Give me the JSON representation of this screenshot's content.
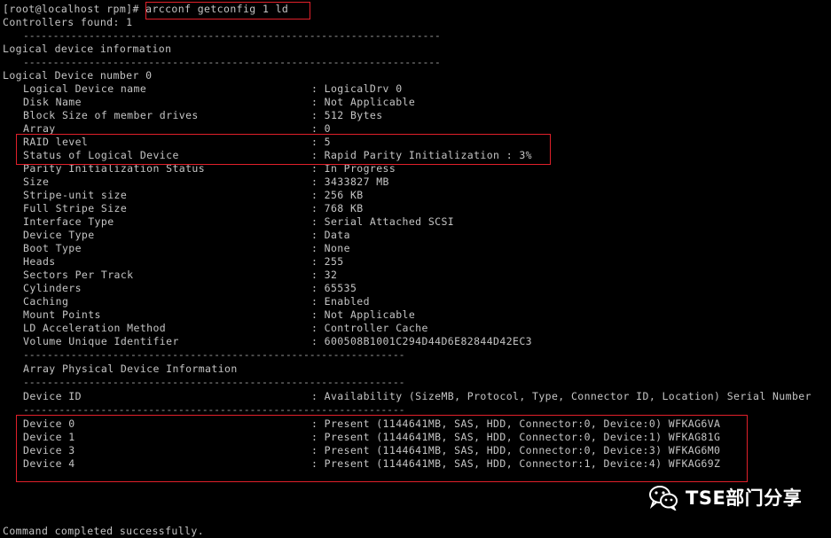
{
  "terminal": {
    "prompt": "[root@localhost rpm]#",
    "command": "arcconf getconfig 1 ld",
    "controllers_found": "Controllers found: 1",
    "separator": "----------------------------------------------------------------------",
    "section_title": "Logical device information",
    "ld_number_line": "Logical Device number 0",
    "properties": [
      {
        "key": "Logical Device name",
        "value": ": LogicalDrv 0"
      },
      {
        "key": "Disk Name",
        "value": ": Not Applicable"
      },
      {
        "key": "Block Size of member drives",
        "value": ": 512 Bytes"
      },
      {
        "key": "Array",
        "value": ": 0"
      },
      {
        "key": "RAID level",
        "value": ": 5"
      },
      {
        "key": "Status of Logical Device",
        "value": ": Rapid Parity Initialization : 3%"
      },
      {
        "key": "Parity Initialization Status",
        "value": ": In Progress"
      },
      {
        "key": "Size",
        "value": ": 3433827 MB"
      },
      {
        "key": "Stripe-unit size",
        "value": ": 256 KB"
      },
      {
        "key": "Full Stripe Size",
        "value": ": 768 KB"
      },
      {
        "key": "Interface Type",
        "value": ": Serial Attached SCSI"
      },
      {
        "key": "Device Type",
        "value": ": Data"
      },
      {
        "key": "Boot Type",
        "value": ": None"
      },
      {
        "key": "Heads",
        "value": ": 255"
      },
      {
        "key": "Sectors Per Track",
        "value": ": 32"
      },
      {
        "key": "Cylinders",
        "value": ": 65535"
      },
      {
        "key": "Caching",
        "value": ": Enabled"
      },
      {
        "key": "Mount Points",
        "value": ": Not Applicable"
      },
      {
        "key": "LD Acceleration Method",
        "value": ": Controller Cache"
      },
      {
        "key": "Volume Unique Identifier",
        "value": ": 600508B1001C294D44D6E82844D42EC3"
      }
    ],
    "sub_separator": "----------------------------------------------------------------",
    "array_section_title": "Array Physical Device Information",
    "device_header": {
      "key": "Device ID",
      "value": ": Availability (SizeMB, Protocol, Type, Connector ID, Location) Serial Number"
    },
    "devices": [
      {
        "key": "Device 0",
        "value": ": Present (1144641MB, SAS, HDD, Connector:0, Device:0) WFKAG6VA"
      },
      {
        "key": "Device 1",
        "value": ": Present (1144641MB, SAS, HDD, Connector:0, Device:1) WFKAG81G"
      },
      {
        "key": "Device 3",
        "value": ": Present (1144641MB, SAS, HDD, Connector:0, Device:3) WFKAG6M0"
      },
      {
        "key": "Device 4",
        "value": ": Present (1144641MB, SAS, HDD, Connector:1, Device:4) WFKAG69Z"
      }
    ],
    "completion": "Command completed successfully."
  },
  "watermark": {
    "text": "TSE部门分享",
    "icon": "wechat-icon"
  },
  "colors": {
    "background": "#000000",
    "text": "#c4c4c4",
    "highlight_box": "#e0202a"
  }
}
